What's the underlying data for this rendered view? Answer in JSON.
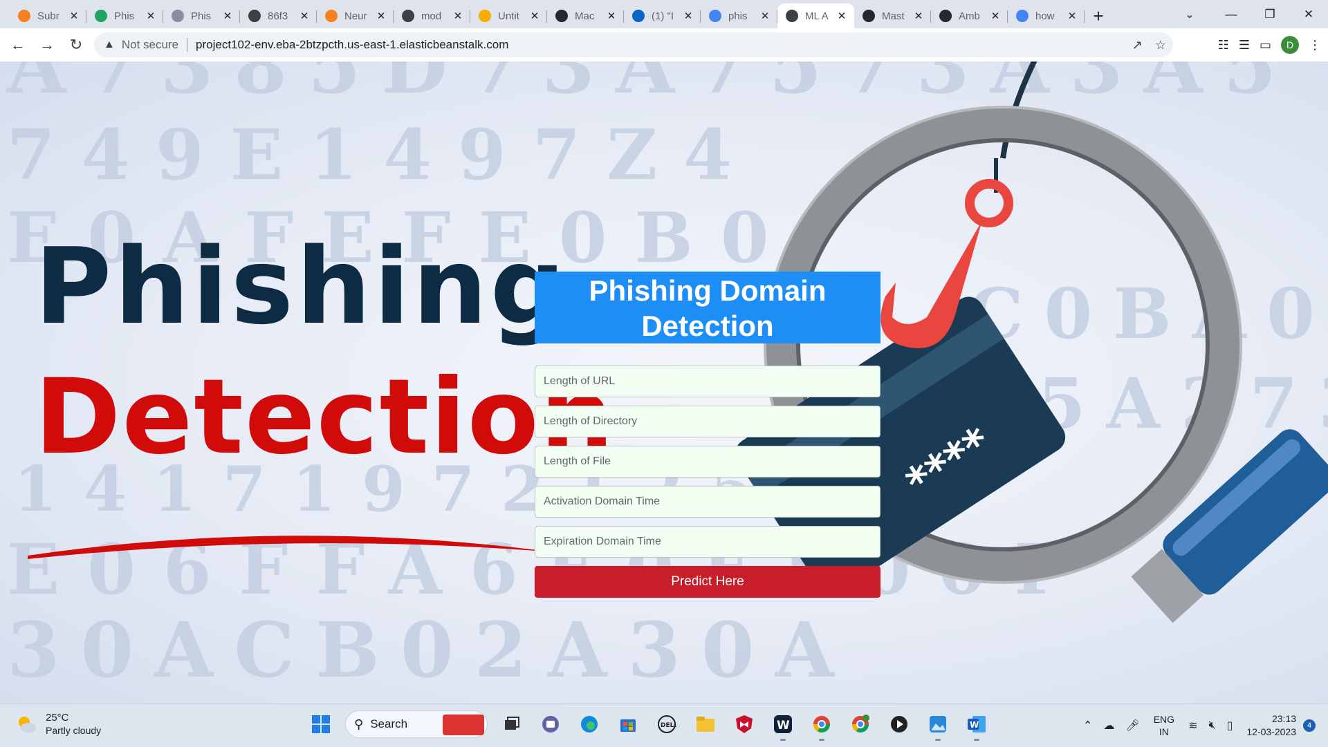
{
  "browser": {
    "tabs": [
      {
        "label": "Subr",
        "icon": "orange-circle-icon",
        "color": "#f5821f",
        "active": false
      },
      {
        "label": "Phis",
        "icon": "google-drive-icon",
        "color": "#1fa463",
        "active": false
      },
      {
        "label": "Phis",
        "icon": "chain-icon",
        "color": "#8a8fa0",
        "active": false
      },
      {
        "label": "86f3",
        "icon": "globe-icon",
        "color": "#3c4043",
        "active": false
      },
      {
        "label": "Neur",
        "icon": "orange-circle-icon",
        "color": "#f5821f",
        "active": false
      },
      {
        "label": "mod",
        "icon": "gear-icon",
        "color": "#3c4043",
        "active": false
      },
      {
        "label": "Untit",
        "icon": "colab-icon",
        "color": "#f9ab00",
        "active": false
      },
      {
        "label": "Mac",
        "icon": "github-icon",
        "color": "#24292e",
        "active": false
      },
      {
        "label": "(1) \"I",
        "icon": "linkedin-icon",
        "color": "#0a66c2",
        "active": false
      },
      {
        "label": "phis",
        "icon": "docs-icon",
        "color": "#4285f4",
        "active": false
      },
      {
        "label": "ML A",
        "icon": "globe-icon",
        "color": "#3c4043",
        "active": true
      },
      {
        "label": "Mast",
        "icon": "github-icon",
        "color": "#24292e",
        "active": false
      },
      {
        "label": "Amb",
        "icon": "github-icon",
        "color": "#24292e",
        "active": false
      },
      {
        "label": "how",
        "icon": "google-icon",
        "color": "#4285f4",
        "active": false
      }
    ],
    "security_label": "Not secure",
    "url": "project102-env.eba-2btzpcth.us-east-1.elasticbeanstalk.com",
    "profile_initial": "D"
  },
  "hero": {
    "line1": "Phishing",
    "line2": "Detection"
  },
  "background_chars": {
    "row1": "A7385D73A7573A3A5",
    "row2": "749E1497Z4",
    "row3": "E0AFEFE0B0",
    "row4": "C0BA0B0A0B5",
    "row5": "5A273A0E1473",
    "row6": "1417197212549",
    "row7": "E06FFA6E0EE00F",
    "row8": "30ACB02A30A"
  },
  "form": {
    "title": "Phishing Domain Detection",
    "fields": [
      {
        "placeholder": "Length of URL"
      },
      {
        "placeholder": "Length of Directory"
      },
      {
        "placeholder": "Length of File"
      },
      {
        "placeholder": "Activation Domain Time"
      },
      {
        "placeholder": "Expiration Domain Time"
      }
    ],
    "submit_label": "Predict Here",
    "colors": {
      "header": "#1e8ef7",
      "button": "#c81e2b",
      "field_bg": "#f4fff4"
    }
  },
  "card": {
    "mask": "****"
  },
  "taskbar": {
    "weather_temp": "25°C",
    "weather_desc": "Partly cloudy",
    "search_label": "Search",
    "lang_line1": "ENG",
    "lang_line2": "IN",
    "time": "23:13",
    "date": "12-03-2023",
    "notification_count": "4"
  }
}
